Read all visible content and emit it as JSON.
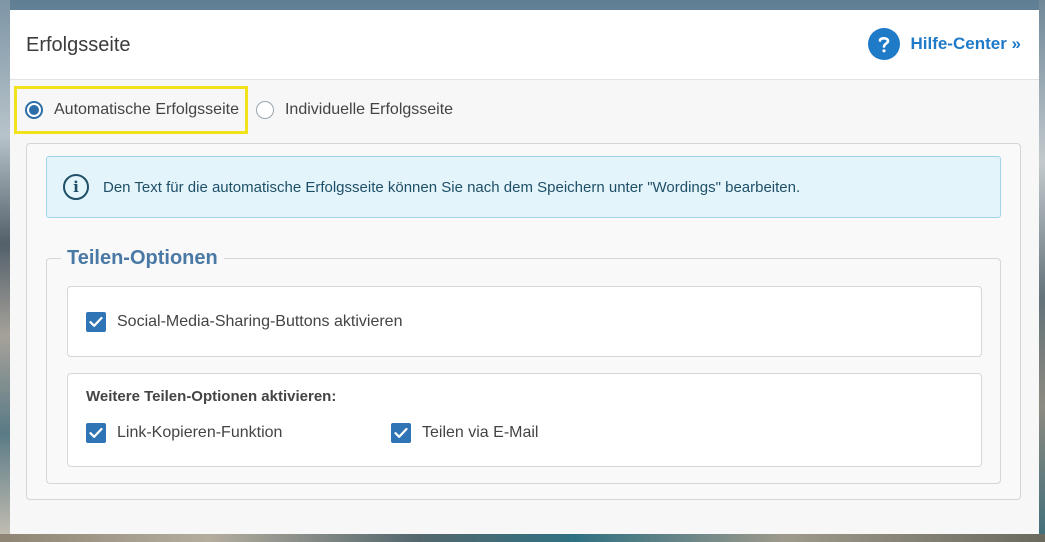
{
  "modal": {
    "title": "Erfolgsseite",
    "help_link": "Hilfe-Center »"
  },
  "radio_options": [
    {
      "label": "Automatische Erfolgsseite",
      "selected": true
    },
    {
      "label": "Individuelle Erfolgsseite",
      "selected": false
    }
  ],
  "info": {
    "text": "Den Text für die automatische Erfolgsseite können Sie nach dem Speichern unter \"Wordings\" bearbeiten."
  },
  "share_options": {
    "legend": "Teilen-Optionen",
    "social_media": {
      "label": "Social-Media-Sharing-Buttons aktivieren",
      "checked": true
    },
    "more_heading": "Weitere Teilen-Optionen aktivieren:",
    "copy_link": {
      "label": "Link-Kopieren-Funktion",
      "checked": true
    },
    "email": {
      "label": "Teilen via E-Mail",
      "checked": true
    }
  },
  "colors": {
    "accent": "#2f74b5",
    "link": "#1f7bc8",
    "info_bg": "#e3f4fb",
    "highlight": "#f2e21c"
  },
  "icons": {
    "help": "question-circle-icon",
    "info": "info-circle-icon",
    "check": "checkmark-icon"
  }
}
